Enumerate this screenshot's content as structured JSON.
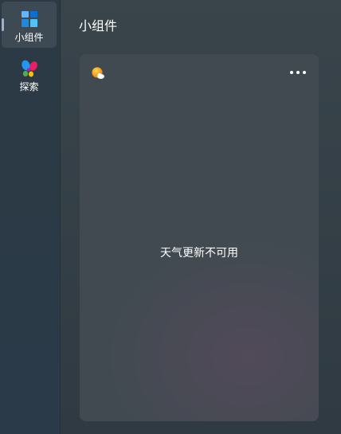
{
  "sidebar": {
    "items": [
      {
        "label": "小组件",
        "icon": "widgets-icon",
        "active": true
      },
      {
        "label": "探索",
        "icon": "discover-icon",
        "active": false
      }
    ]
  },
  "header": {
    "title": "小组件"
  },
  "weather_widget": {
    "icon": "weather-partly-sunny-icon",
    "menu_icon": "more-options-icon",
    "message": "天气更新不可用"
  },
  "colors": {
    "active_indicator": "#9fb3c4",
    "card_background": "#414a51",
    "sidebar_background": "#2d3a45"
  }
}
